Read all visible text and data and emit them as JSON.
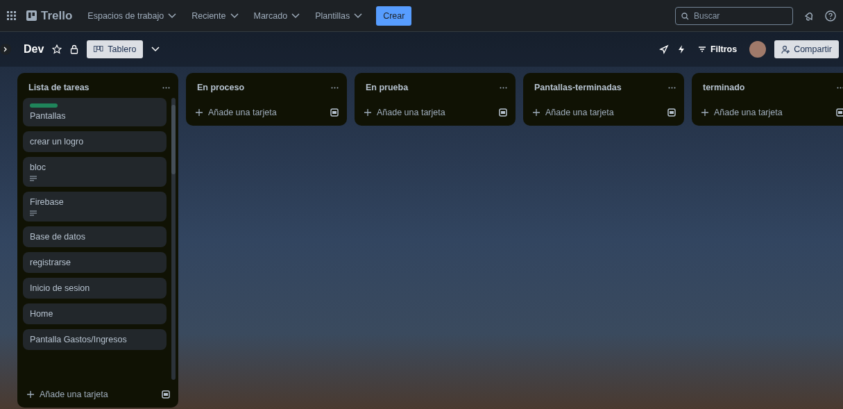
{
  "topbar": {
    "logo": "Trello",
    "menus": [
      {
        "label": "Espacios de trabajo"
      },
      {
        "label": "Reciente"
      },
      {
        "label": "Marcado"
      },
      {
        "label": "Plantillas"
      }
    ],
    "create_button": "Crear",
    "search": {
      "placeholder": "Buscar"
    }
  },
  "board_header": {
    "title": "Dev",
    "starred": false,
    "view_button": "Tablero",
    "filters_button": "Filtros",
    "share_button": "Compartir"
  },
  "lists": [
    {
      "title": "Lista de tareas",
      "add_card": "Añade una tarjeta",
      "cards": [
        {
          "title": "Pantallas",
          "color": "#1f845a",
          "has_description": false
        },
        {
          "title": "crear un logro",
          "has_description": false
        },
        {
          "title": "bloc",
          "has_description": true
        },
        {
          "title": "Firebase",
          "has_description": true
        },
        {
          "title": "Base de datos",
          "has_description": false
        },
        {
          "title": "registrarse",
          "has_description": false
        },
        {
          "title": "Inicio de sesion",
          "has_description": false
        },
        {
          "title": "Home",
          "has_description": false
        },
        {
          "title": "Pantalla Gastos/Ingresos",
          "has_description": false
        }
      ]
    },
    {
      "title": "En proceso",
      "add_card": "Añade una tarjeta"
    },
    {
      "title": "En prueba",
      "add_card": "Añade una tarjeta"
    },
    {
      "title": "Pantallas-terminadas",
      "add_card": "Añade una tarjeta"
    },
    {
      "title": "terminado",
      "add_card": "Añade una tarjeta"
    }
  ]
}
